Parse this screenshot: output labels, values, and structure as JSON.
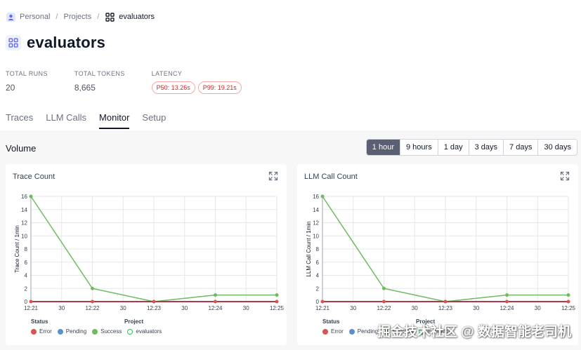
{
  "breadcrumb": {
    "items": [
      "Personal",
      "Projects"
    ],
    "current": "evaluators"
  },
  "page": {
    "title": "evaluators"
  },
  "stats": {
    "total_runs_label": "TOTAL RUNS",
    "total_runs_value": "20",
    "total_tokens_label": "TOTAL TOKENS",
    "total_tokens_value": "8,665",
    "latency_label": "LATENCY",
    "p50": "P50: 13.26s",
    "p99": "P99: 19.21s"
  },
  "tabs": [
    {
      "label": "Traces"
    },
    {
      "label": "LLM Calls"
    },
    {
      "label": "Monitor",
      "active": true
    },
    {
      "label": "Setup"
    }
  ],
  "volume": {
    "title": "Volume",
    "ranges": [
      "1 hour",
      "9 hours",
      "1 day",
      "3 days",
      "7 days",
      "30 days"
    ],
    "selected_range": "1 hour"
  },
  "colors": {
    "success": "#6dbb5e",
    "error": "#d9534f",
    "pending": "#5b8fd0",
    "error_line": "#b0374a",
    "grid": "#e5e7eb"
  },
  "legend": {
    "status_label": "Status",
    "project_label": "Project",
    "status_items": [
      "Error",
      "Pending",
      "Success"
    ],
    "project_items": [
      "evaluators"
    ]
  },
  "chart_data": [
    {
      "type": "line",
      "title": "Trace Count",
      "ylabel": "Trace Count / 1min",
      "xlabel": "",
      "x": [
        "12:21",
        "30",
        "12:22",
        "30",
        "12:23",
        "30",
        "12:24",
        "30",
        "12:25"
      ],
      "y_ticks": [
        0,
        2,
        4,
        6,
        8,
        10,
        12,
        14,
        16
      ],
      "ylim": [
        0,
        16
      ],
      "series": [
        {
          "name": "Success",
          "x": [
            "12:21",
            "12:22",
            "12:23",
            "12:24",
            "12:25"
          ],
          "values": [
            16,
            2,
            0,
            1,
            1
          ]
        },
        {
          "name": "Error",
          "x": [
            "12:21",
            "12:22",
            "12:23",
            "12:24",
            "12:25"
          ],
          "values": [
            0,
            0,
            0,
            0,
            0
          ]
        }
      ]
    },
    {
      "type": "line",
      "title": "LLM Call Count",
      "ylabel": "LLM Call Count / 1min",
      "xlabel": "",
      "x": [
        "12:21",
        "30",
        "12:22",
        "30",
        "12:23",
        "30",
        "12:24",
        "30",
        "12:25"
      ],
      "y_ticks": [
        0,
        2,
        4,
        6,
        8,
        10,
        12,
        14,
        16
      ],
      "ylim": [
        0,
        16
      ],
      "series": [
        {
          "name": "Success",
          "x": [
            "12:21",
            "12:22",
            "12:23",
            "12:24",
            "12:25"
          ],
          "values": [
            16,
            2,
            0,
            1,
            1
          ]
        },
        {
          "name": "Error",
          "x": [
            "12:21",
            "12:22",
            "12:23",
            "12:24",
            "12:25"
          ],
          "values": [
            0,
            0,
            0,
            0,
            0
          ]
        }
      ]
    }
  ],
  "watermark": "掘金技术社区 @ 数据智能老司机"
}
